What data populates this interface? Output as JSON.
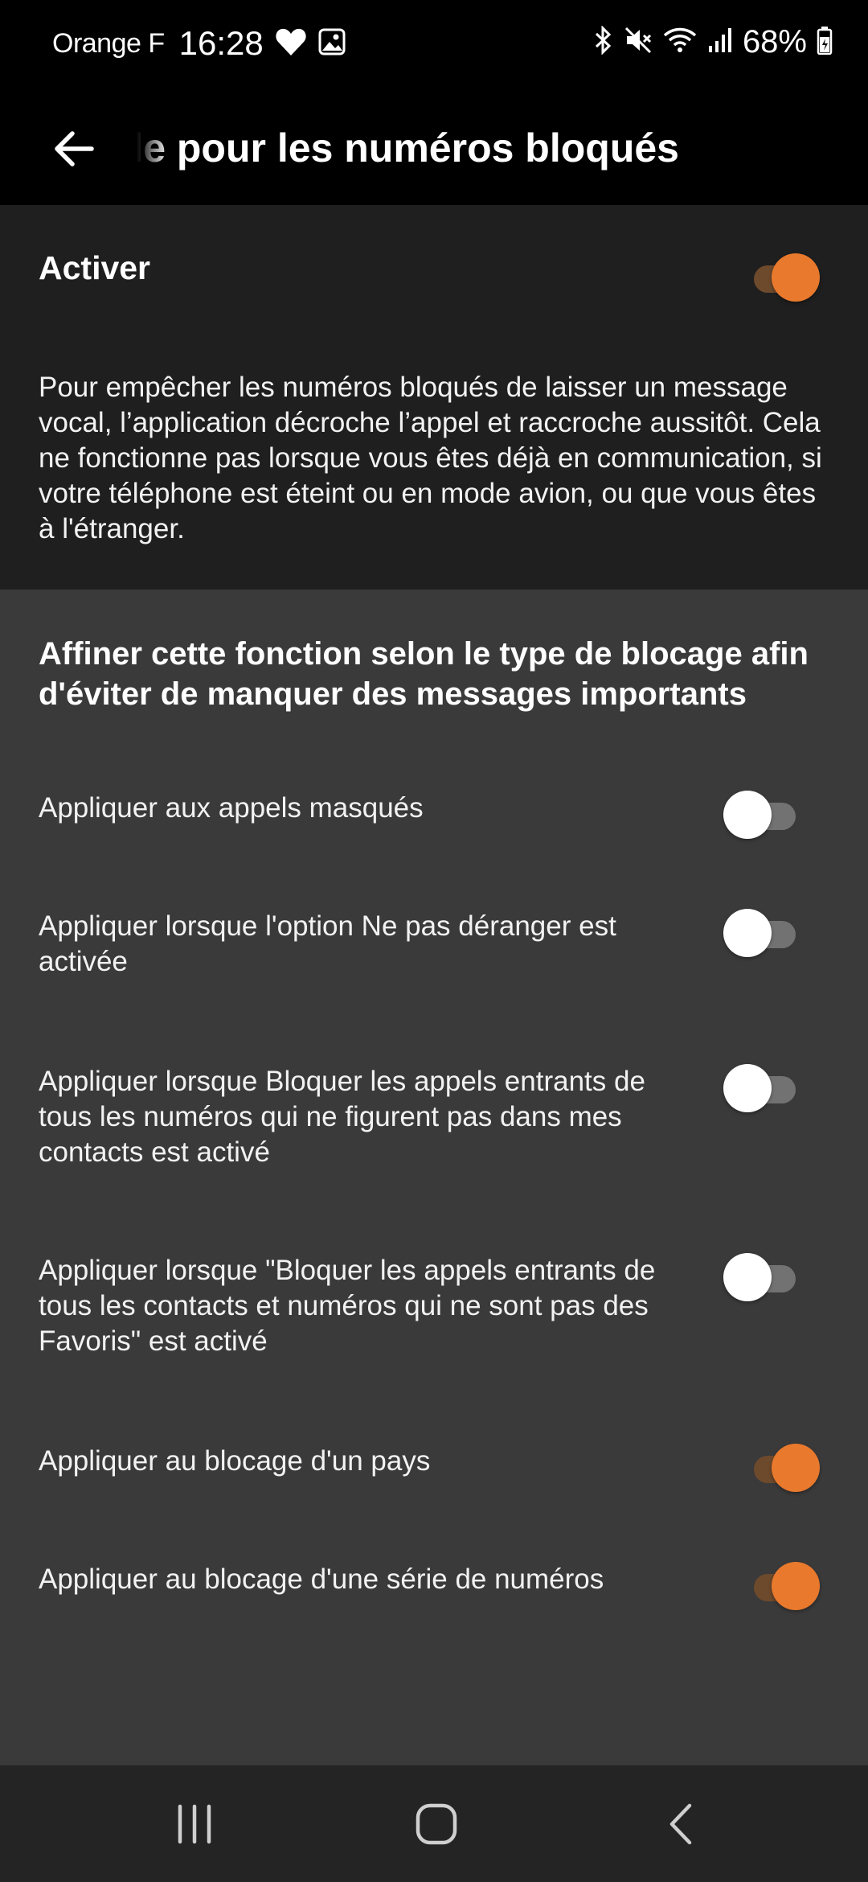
{
  "status_bar": {
    "carrier": "Orange F",
    "time": "16:28",
    "battery": "68%",
    "icons": [
      "heart-icon",
      "image-icon",
      "bluetooth-icon",
      "mute-icon",
      "wifi-icon",
      "signal-icon",
      "battery-icon"
    ]
  },
  "app_bar": {
    "title": "le pour les numéros bloqués"
  },
  "main": {
    "label": "Activer",
    "enabled": true,
    "description": "Pour empêcher les numéros bloqués de laisser un message vocal, l’application décroche l’appel et raccroche aussitôt. Cela ne fonctionne pas lorsque vous êtes déjà en communication, si votre téléphone est éteint ou en mode avion, ou que vous êtes à l'étranger."
  },
  "options": {
    "header": "Affiner cette fonction selon le type de blocage afin d'éviter de manquer des messages importants",
    "items": [
      {
        "label": "Appliquer aux appels masqués",
        "enabled": false
      },
      {
        "label": "Appliquer lorsque l'option Ne pas déranger est activée",
        "enabled": false
      },
      {
        "label": "Appliquer lorsque Bloquer les appels entrants de tous les numéros qui ne figurent pas dans mes contacts est activé",
        "enabled": false
      },
      {
        "label": "Appliquer lorsque \"Bloquer les appels entrants de tous les contacts et numéros qui ne sont pas des Favoris\" est activé",
        "enabled": false
      },
      {
        "label": "Appliquer au blocage d'un pays",
        "enabled": true
      },
      {
        "label": "Appliquer au blocage d'une série de numéros",
        "enabled": true
      }
    ]
  },
  "colors": {
    "accent": "#e8792d",
    "accent_track": "#6e4a2c",
    "section_dark": "#1f1f1f",
    "section_grey": "#3a3a3a",
    "nav_bar": "#242424"
  }
}
